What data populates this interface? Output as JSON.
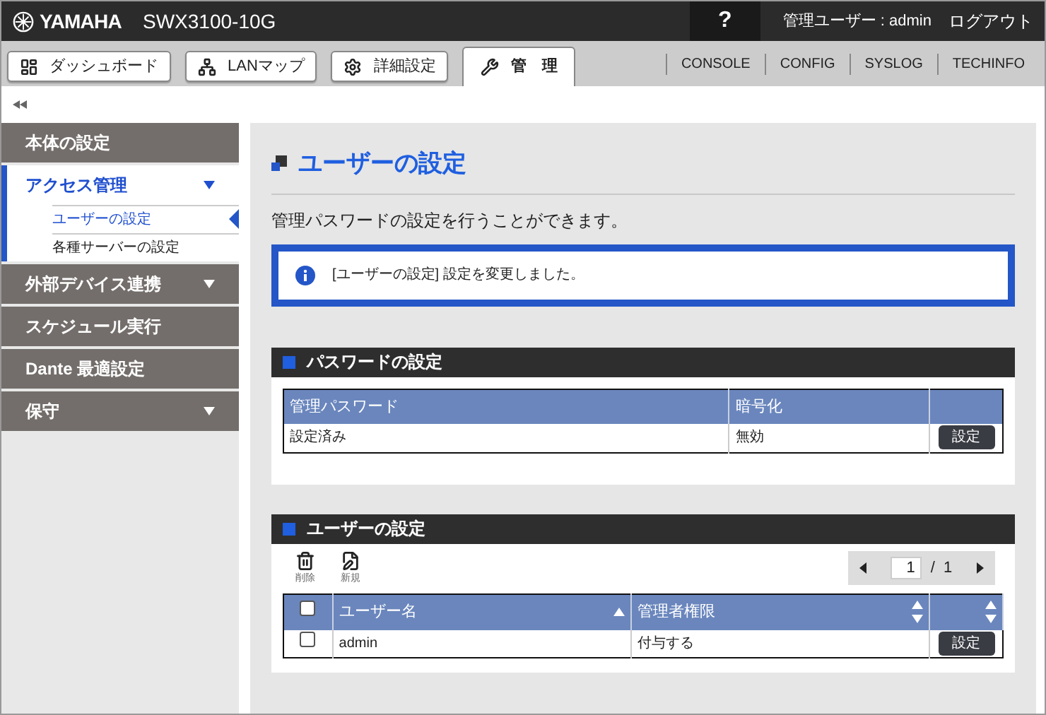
{
  "header": {
    "logo": "YAMAHA",
    "model": "SWX3100-10G",
    "help": "?",
    "user": "管理ユーザー : admin",
    "logout": "ログアウト"
  },
  "tabs": [
    {
      "label": "ダッシュボード",
      "kind": "dashboard",
      "selected": false
    },
    {
      "label": "LANマップ",
      "kind": "map",
      "selected": false
    },
    {
      "label": "詳細設定",
      "kind": "gear",
      "selected": false
    },
    {
      "label": "管　理",
      "kind": "wrench",
      "selected": true
    }
  ],
  "links": [
    "CONSOLE",
    "CONFIG",
    "SYSLOG",
    "TECHINFO"
  ],
  "sidebar": {
    "items": [
      {
        "label": "本体の設定",
        "expandable": false,
        "expanded": false
      },
      {
        "label": "アクセス管理",
        "expandable": true,
        "expanded": true,
        "children": [
          {
            "label": "ユーザーの設定",
            "selected": true
          },
          {
            "label": "各種サーバーの設定",
            "selected": false
          }
        ]
      },
      {
        "label": "外部デバイス連携",
        "expandable": true,
        "expanded": false
      },
      {
        "label": "スケジュール実行",
        "expandable": false,
        "expanded": false
      },
      {
        "label": "Dante 最適設定",
        "expandable": false,
        "expanded": false
      },
      {
        "label": "保守",
        "expandable": true,
        "expanded": false
      }
    ]
  },
  "page": {
    "title": "ユーザーの設定",
    "description": "管理パスワードの設定を行うことができます。",
    "notice": "[ユーザーの設定] 設定を変更しました。"
  },
  "password_section": {
    "title": "パスワードの設定",
    "columns": [
      "管理パスワード",
      "暗号化"
    ],
    "rows": [
      {
        "cells": [
          "設定済み",
          "無効"
        ],
        "button": "設定"
      }
    ]
  },
  "user_section": {
    "title": "ユーザーの設定",
    "actions": [
      {
        "label": "削除",
        "kind": "delete"
      },
      {
        "label": "新規",
        "kind": "new"
      }
    ],
    "pager": {
      "page": "1",
      "separator": "/",
      "total": "1"
    },
    "columns": [
      {
        "label": "ユーザー名",
        "sorted": true
      },
      {
        "label": "管理者権限",
        "sorted": false
      },
      {
        "sorted": false
      }
    ],
    "select_all": {
      "checked": false
    },
    "rows": [
      {
        "checked": false,
        "cells": [
          "admin",
          "付与する"
        ],
        "button": "設定"
      }
    ]
  }
}
